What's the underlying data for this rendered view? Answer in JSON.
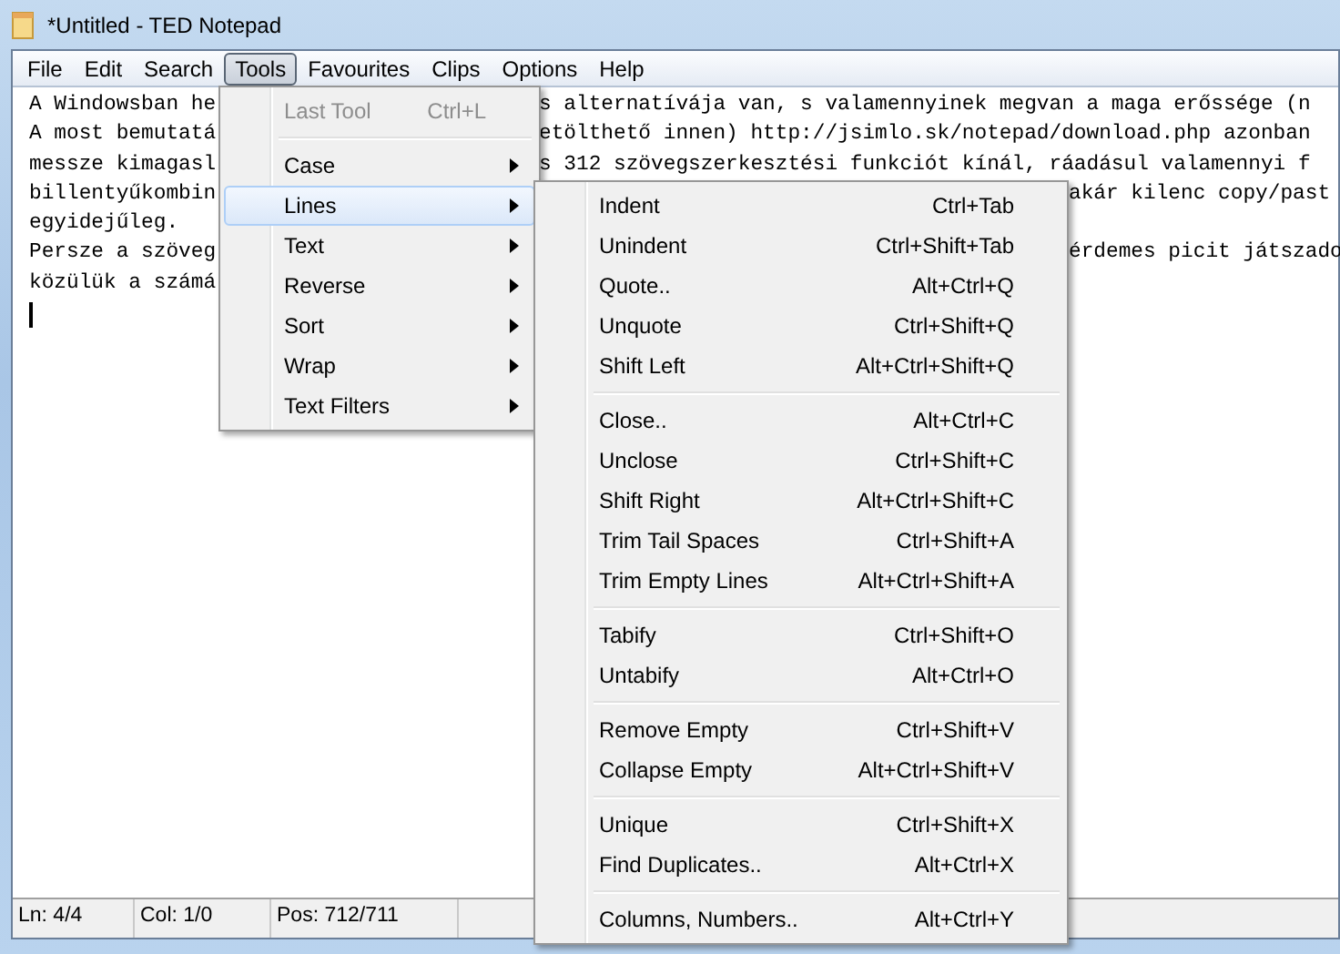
{
  "window": {
    "title": "*Untitled - TED Notepad"
  },
  "menu_bar": [
    {
      "label": "File",
      "selected": false
    },
    {
      "label": "Edit",
      "selected": false
    },
    {
      "label": "Search",
      "selected": false
    },
    {
      "label": "Tools",
      "selected": true
    },
    {
      "label": "Favourites",
      "selected": false
    },
    {
      "label": "Clips",
      "selected": false
    },
    {
      "label": "Options",
      "selected": false
    },
    {
      "label": "Help",
      "selected": false
    }
  ],
  "editor_lines": [
    {
      "left": "A Windowsban he",
      "right": "s alternatívája van, s valamennyinek megvan a maga erőssége (n",
      "kind": "behind-menu"
    },
    {
      "left": "A most bemutatá",
      "right": "etölthető innen) http://jsimlo.sk/notepad/download.php azonban",
      "kind": "behind-menu"
    },
    {
      "left": "messze kimagasl",
      "right": "s 312 szövegszerkesztési funkciót kínál, ráadásul valamennyi f",
      "kind": "behind-menu"
    },
    {
      "left": "billentyűkombin",
      "right": "akár kilenc copy/past",
      "kind": "behind-submenu"
    },
    {
      "left": "egyidejűleg."
    },
    {
      "left": "Persze a szöveg",
      "right": "érdemes picit játszado",
      "kind": "behind-submenu"
    },
    {
      "left": "közülük a számá"
    }
  ],
  "tools_menu": [
    {
      "kind": "item",
      "label": "Last Tool",
      "shortcut": "Ctrl+L",
      "disabled": true,
      "selected": false
    },
    {
      "kind": "separator"
    },
    {
      "kind": "submenu",
      "label": "Case",
      "selected": false
    },
    {
      "kind": "submenu",
      "label": "Lines",
      "selected": true
    },
    {
      "kind": "submenu",
      "label": "Text",
      "selected": false
    },
    {
      "kind": "submenu",
      "label": "Reverse",
      "selected": false
    },
    {
      "kind": "submenu",
      "label": "Sort",
      "selected": false
    },
    {
      "kind": "submenu",
      "label": "Wrap",
      "selected": false
    },
    {
      "kind": "submenu",
      "label": "Text Filters",
      "selected": false
    }
  ],
  "lines_submenu": [
    {
      "kind": "item",
      "label": "Indent",
      "shortcut": "Ctrl+Tab"
    },
    {
      "kind": "item",
      "label": "Unindent",
      "shortcut": "Ctrl+Shift+Tab"
    },
    {
      "kind": "item",
      "label": "Quote..",
      "shortcut": "Alt+Ctrl+Q"
    },
    {
      "kind": "item",
      "label": "Unquote",
      "shortcut": "Ctrl+Shift+Q"
    },
    {
      "kind": "item",
      "label": "Shift Left",
      "shortcut": "Alt+Ctrl+Shift+Q"
    },
    {
      "kind": "separator"
    },
    {
      "kind": "item",
      "label": "Close..",
      "shortcut": "Alt+Ctrl+C"
    },
    {
      "kind": "item",
      "label": "Unclose",
      "shortcut": "Ctrl+Shift+C"
    },
    {
      "kind": "item",
      "label": "Shift Right",
      "shortcut": "Alt+Ctrl+Shift+C"
    },
    {
      "kind": "item",
      "label": "Trim Tail Spaces",
      "shortcut": "Ctrl+Shift+A"
    },
    {
      "kind": "item",
      "label": "Trim Empty Lines",
      "shortcut": "Alt+Ctrl+Shift+A"
    },
    {
      "kind": "separator"
    },
    {
      "kind": "item",
      "label": "Tabify",
      "shortcut": "Ctrl+Shift+O"
    },
    {
      "kind": "item",
      "label": "Untabify",
      "shortcut": "Alt+Ctrl+O"
    },
    {
      "kind": "separator"
    },
    {
      "kind": "item",
      "label": "Remove Empty",
      "shortcut": "Ctrl+Shift+V"
    },
    {
      "kind": "item",
      "label": "Collapse Empty",
      "shortcut": "Alt+Ctrl+Shift+V"
    },
    {
      "kind": "separator"
    },
    {
      "kind": "item",
      "label": "Unique",
      "shortcut": "Ctrl+Shift+X"
    },
    {
      "kind": "item",
      "label": "Find Duplicates..",
      "shortcut": "Alt+Ctrl+X"
    },
    {
      "kind": "separator"
    },
    {
      "kind": "item",
      "label": "Columns, Numbers..",
      "shortcut": "Alt+Ctrl+Y"
    }
  ],
  "status_bar": [
    "Ln: 4/4",
    "Col: 1/0",
    "Pos: 712/711"
  ]
}
